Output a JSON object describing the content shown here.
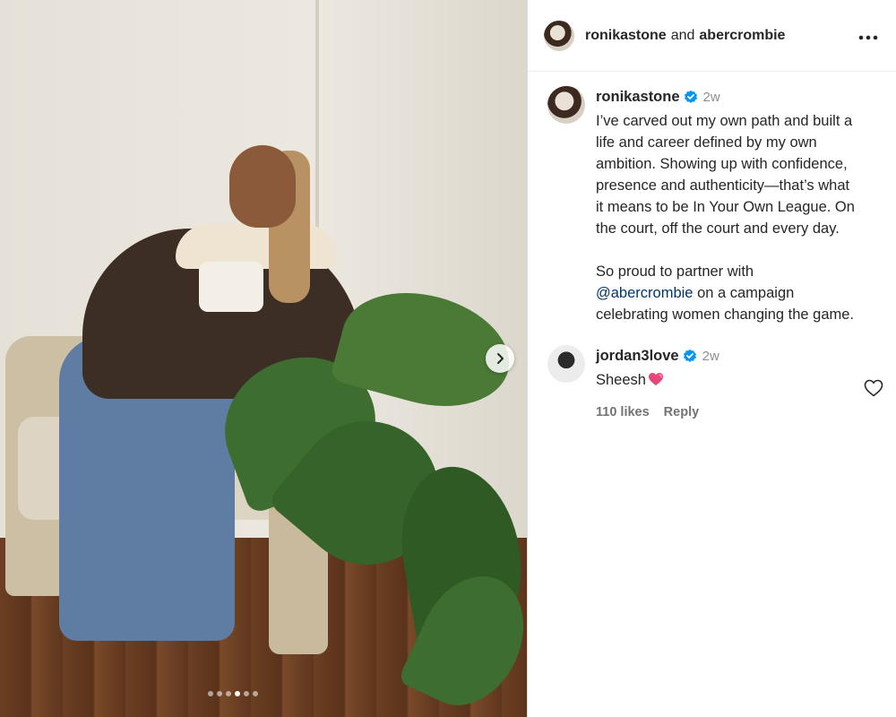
{
  "post": {
    "author": "ronikastone",
    "collab_joiner": "and",
    "collaborator": "abercrombie",
    "more_icon": "more-horizontal-icon"
  },
  "caption": {
    "username": "ronikastone",
    "verified": true,
    "time": "2w",
    "paragraph1": "I’ve carved out my own path and built a\nlife and career defined by my own\nambition. Showing up with confidence,\npresence and authenticity—that’s what\nit means to be In Your Own League. On\nthe court, off the court and every day.",
    "paragraph2_before": "So proud to partner with",
    "paragraph2_mention": "@abercrombie",
    "paragraph2_after": "on a campaign\ncelebrating women changing the game."
  },
  "comments": [
    {
      "username": "jordan3love",
      "verified": true,
      "time": "2w",
      "text": "Sheesh",
      "emoji": "heart-emoji",
      "likes": "110 likes",
      "reply_label": "Reply"
    }
  ],
  "carousel": {
    "total": 6,
    "active_index": 3,
    "next_icon": "chevron-right-icon"
  },
  "colors": {
    "link": "#00376b",
    "verified": "#0095f6",
    "muted": "#737373"
  }
}
